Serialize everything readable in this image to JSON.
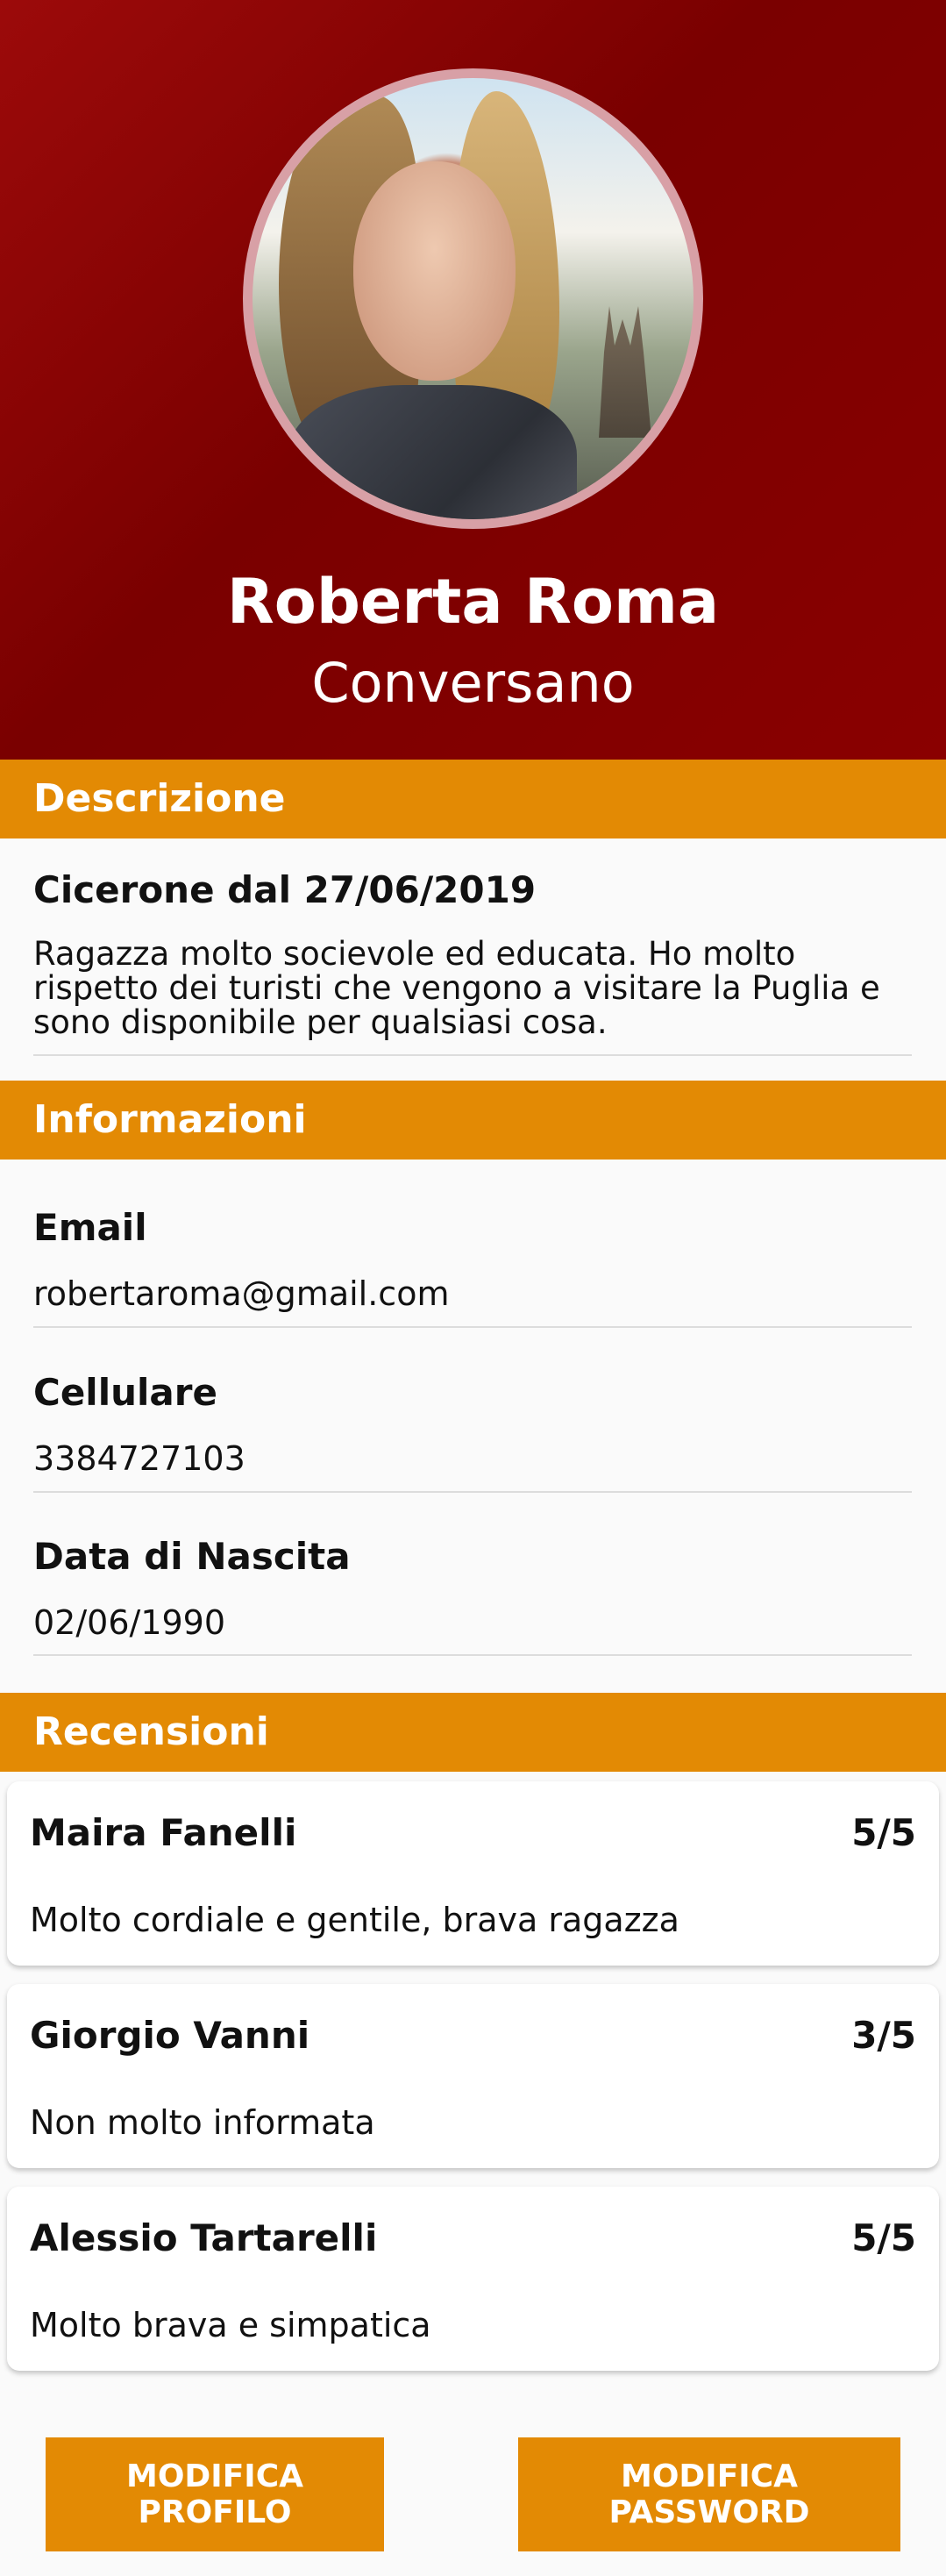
{
  "profile": {
    "name": "Roberta Roma",
    "city": "Conversano"
  },
  "description": {
    "section_title": "Descrizione",
    "since": "Cicerone dal 27/06/2019",
    "text": "Ragazza molto socievole ed educata. Ho molto rispetto dei turisti che vengono a visitare la Puglia e sono disponibile per qualsiasi cosa."
  },
  "info": {
    "section_title": "Informazioni",
    "email_label": "Email",
    "email_value": "robertaroma@gmail.com",
    "phone_label": "Cellulare",
    "phone_value": "3384727103",
    "birth_label": "Data di Nascita",
    "birth_value": "02/06/1990"
  },
  "reviews": {
    "section_title": "Recensioni",
    "items": [
      {
        "author": "Maira Fanelli",
        "score": "5/5",
        "text": "Molto cordiale e gentile, brava ragazza"
      },
      {
        "author": "Giorgio Vanni",
        "score": "3/5",
        "text": "Non molto informata"
      },
      {
        "author": "Alessio Tartarelli",
        "score": "5/5",
        "text": "Molto brava e simpatica"
      }
    ]
  },
  "actions": {
    "edit_profile": "MODIFICA PROFILO",
    "edit_password": "MODIFICA PASSWORD"
  },
  "colors": {
    "header": "#8a0000",
    "accent": "#e38a04",
    "background": "#fafafa"
  }
}
